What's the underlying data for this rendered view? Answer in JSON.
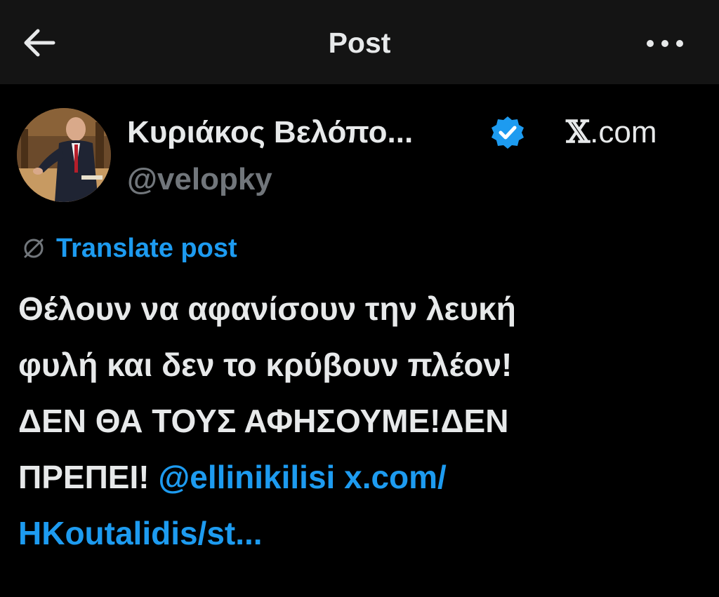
{
  "header": {
    "title": "Post",
    "back_icon": "arrow-left-icon",
    "more_icon": "more-horizontal-icon"
  },
  "author": {
    "name": "Κυριάκος Βελόπο...",
    "handle": "@velopky",
    "verified_icon": "verified-badge-icon",
    "verified_color": "#1d9bf0"
  },
  "source": {
    "logo": "𝕏",
    "domain": ".com"
  },
  "translate": {
    "icon": "translate-globe-icon",
    "label": "Translate post"
  },
  "post": {
    "line1": "Θέλουν να αφανίσουν την λευκή",
    "line2": "φυλή και δεν το κρύβουν πλέον!",
    "line3": "ΔΕΝ ΘΑ ΤΟΥΣ ΑΦΗΣΟΥΜΕ!ΔΕΝ",
    "line4_text": "ΠΡΕΠΕΙ! ",
    "mention": "@ellinikilisi",
    "link_part1": "x.com/",
    "link_part2": "HKoutalidis/st..."
  },
  "colors": {
    "background": "#000000",
    "topbar": "#141414",
    "text": "#e7e9ea",
    "muted": "#71767b",
    "accent": "#1d9bf0"
  }
}
